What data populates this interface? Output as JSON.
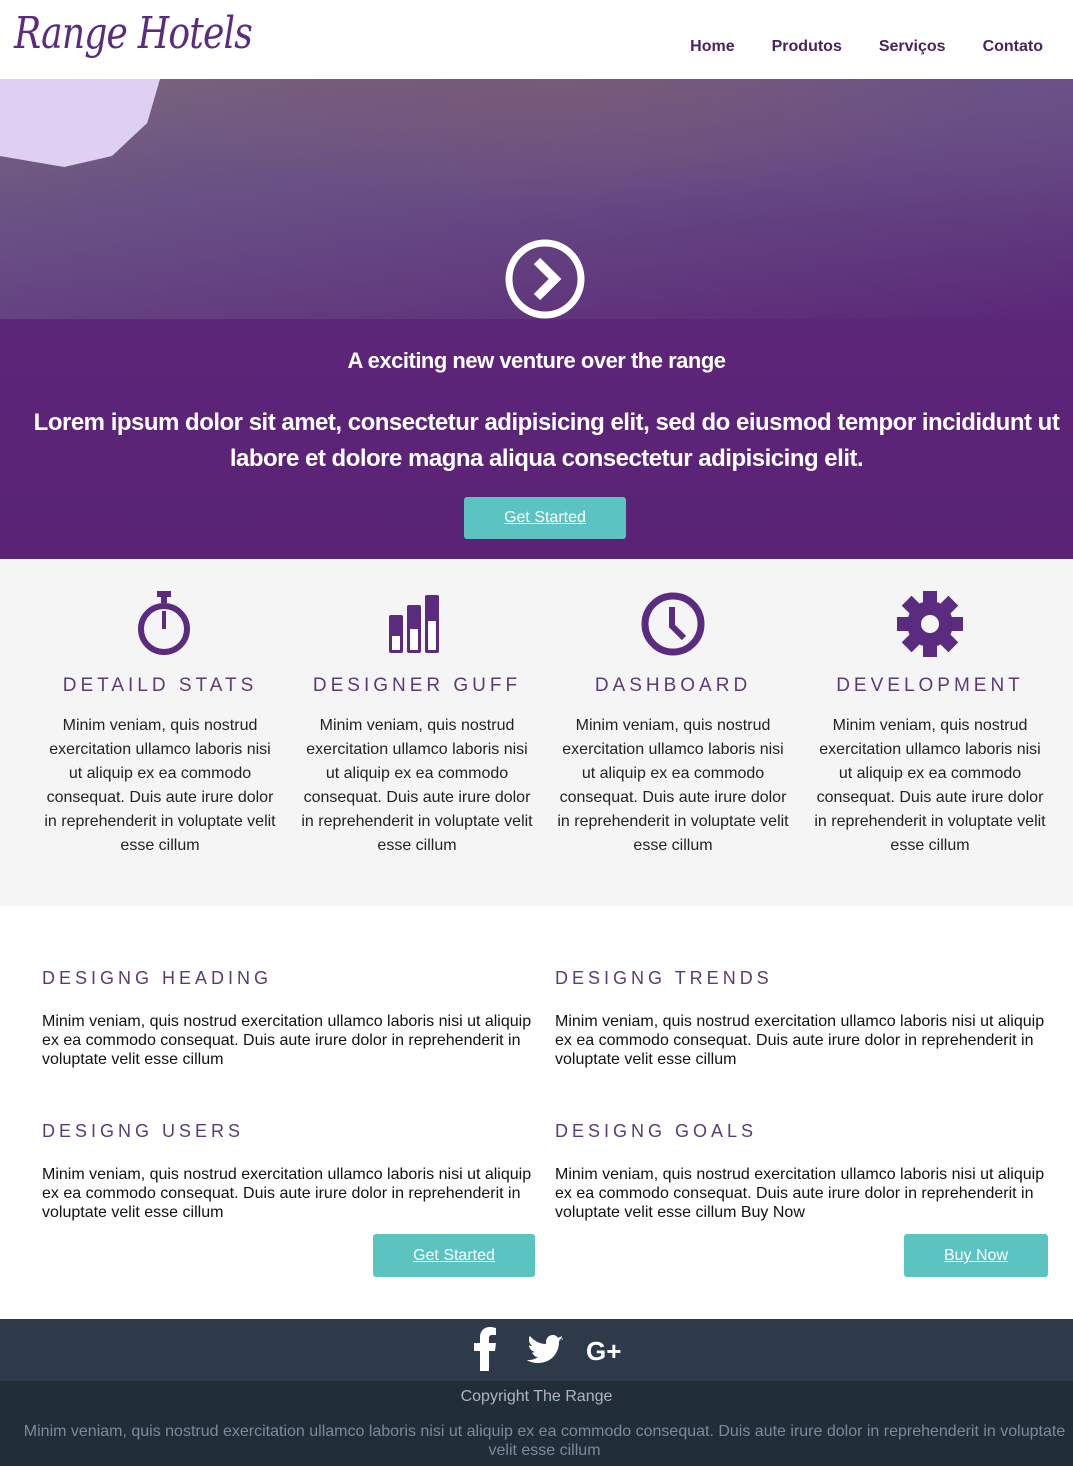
{
  "header": {
    "logo": "Range Hotels",
    "nav": [
      "Home",
      "Produtos",
      "Serviços",
      "Contato"
    ]
  },
  "hero": {
    "arrow_icon": "chevron-right-circle-icon",
    "tagline": "A exciting new venture over the range",
    "text": "Lorem ipsum dolor sit amet, consectetur adipisicing elit, sed do eiusmod tempor incididunt ut labore et dolore magna aliqua consectetur adipisicing elit.",
    "button": "Get Started"
  },
  "features": [
    {
      "icon": "stopwatch-icon",
      "title": "DETAILD STATS",
      "text": "Minim veniam, quis nostrud exercitation ullamco laboris nisi ut aliquip ex ea commodo consequat. Duis aute irure dolor in reprehenderit in voluptate velit esse cillum"
    },
    {
      "icon": "bar-chart-icon",
      "title": "DESIGNER GUFF",
      "text": "Minim veniam, quis nostrud exercitation ullamco laboris nisi ut aliquip ex ea commodo consequat. Duis aute irure dolor in reprehenderit in voluptate velit esse cillum"
    },
    {
      "icon": "clock-icon",
      "title": "DASHBOARD",
      "text": "Minim veniam, quis nostrud exercitation ullamco laboris nisi ut aliquip ex ea commodo consequat. Duis aute irure dolor in reprehenderit in voluptate velit esse cillum"
    },
    {
      "icon": "gear-icon",
      "title": "DEVELOPMENT",
      "text": "Minim veniam, quis nostrud exercitation ullamco laboris nisi ut aliquip ex ea commodo consequat. Duis aute irure dolor in reprehenderit in voluptate velit esse cillum"
    }
  ],
  "content": {
    "blocks": [
      {
        "title": "DESIGNG HEADING",
        "text": "Minim veniam, quis nostrud exercitation ullamco laboris nisi ut aliquip ex ea commodo consequat. Duis aute irure dolor in reprehenderit in voluptate velit esse cillum"
      },
      {
        "title": "DESIGNG TRENDS",
        "text": "Minim veniam, quis nostrud exercitation ullamco laboris nisi ut aliquip ex ea commodo consequat. Duis aute irure dolor in reprehenderit in voluptate velit esse cillum"
      },
      {
        "title": "DESIGNG USERS",
        "text": "Minim veniam, quis nostrud exercitation ullamco laboris nisi ut aliquip ex ea commodo consequat. Duis aute irure dolor in reprehenderit in voluptate velit esse cillum"
      },
      {
        "title": "DESIGNG GOALS",
        "text": "Minim veniam, quis nostrud exercitation ullamco laboris nisi ut aliquip ex ea commodo consequat. Duis aute irure dolor in reprehenderit in voluptate velit esse cillum Buy Now"
      }
    ],
    "left_button": "Get Started",
    "right_button": "Buy Now"
  },
  "footer": {
    "social_icons": [
      "facebook-icon",
      "twitter-icon",
      "google-plus-icon"
    ],
    "copyright": "Copyright The Range",
    "text": "Minim veniam, quis nostrud exercitation ullamco laboris nisi ut aliquip ex ea commodo consequat. Duis aute irure dolor in reprehenderit in voluptate velit esse cillum"
  },
  "colors": {
    "brand_purple": "#5b2b7f",
    "accent_teal": "#5bc4c1",
    "footer_dark": "#2e3a4a",
    "footer_darker": "#222d3a"
  }
}
